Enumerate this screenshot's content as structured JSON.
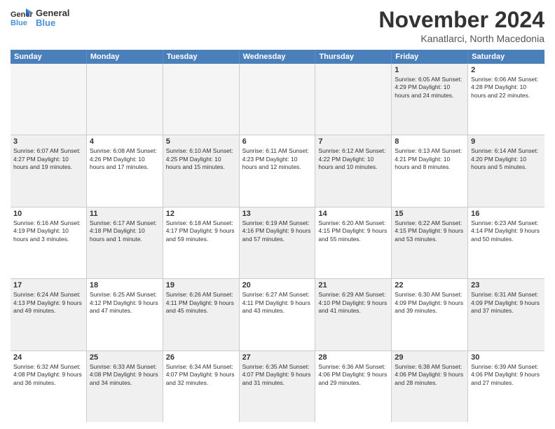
{
  "header": {
    "logo_line1": "General",
    "logo_line2": "Blue",
    "title": "November 2024",
    "location": "Kanatlarci, North Macedonia"
  },
  "weekdays": [
    "Sunday",
    "Monday",
    "Tuesday",
    "Wednesday",
    "Thursday",
    "Friday",
    "Saturday"
  ],
  "weeks": [
    [
      {
        "day": "",
        "info": "",
        "empty": true
      },
      {
        "day": "",
        "info": "",
        "empty": true
      },
      {
        "day": "",
        "info": "",
        "empty": true
      },
      {
        "day": "",
        "info": "",
        "empty": true
      },
      {
        "day": "",
        "info": "",
        "empty": true
      },
      {
        "day": "1",
        "info": "Sunrise: 6:05 AM\nSunset: 4:29 PM\nDaylight: 10 hours\nand 24 minutes.",
        "shaded": true
      },
      {
        "day": "2",
        "info": "Sunrise: 6:06 AM\nSunset: 4:28 PM\nDaylight: 10 hours\nand 22 minutes.",
        "shaded": false
      }
    ],
    [
      {
        "day": "3",
        "info": "Sunrise: 6:07 AM\nSunset: 4:27 PM\nDaylight: 10 hours\nand 19 minutes.",
        "shaded": true
      },
      {
        "day": "4",
        "info": "Sunrise: 6:08 AM\nSunset: 4:26 PM\nDaylight: 10 hours\nand 17 minutes.",
        "shaded": false
      },
      {
        "day": "5",
        "info": "Sunrise: 6:10 AM\nSunset: 4:25 PM\nDaylight: 10 hours\nand 15 minutes.",
        "shaded": true
      },
      {
        "day": "6",
        "info": "Sunrise: 6:11 AM\nSunset: 4:23 PM\nDaylight: 10 hours\nand 12 minutes.",
        "shaded": false
      },
      {
        "day": "7",
        "info": "Sunrise: 6:12 AM\nSunset: 4:22 PM\nDaylight: 10 hours\nand 10 minutes.",
        "shaded": true
      },
      {
        "day": "8",
        "info": "Sunrise: 6:13 AM\nSunset: 4:21 PM\nDaylight: 10 hours\nand 8 minutes.",
        "shaded": false
      },
      {
        "day": "9",
        "info": "Sunrise: 6:14 AM\nSunset: 4:20 PM\nDaylight: 10 hours\nand 5 minutes.",
        "shaded": true
      }
    ],
    [
      {
        "day": "10",
        "info": "Sunrise: 6:16 AM\nSunset: 4:19 PM\nDaylight: 10 hours\nand 3 minutes.",
        "shaded": false
      },
      {
        "day": "11",
        "info": "Sunrise: 6:17 AM\nSunset: 4:18 PM\nDaylight: 10 hours\nand 1 minute.",
        "shaded": true
      },
      {
        "day": "12",
        "info": "Sunrise: 6:18 AM\nSunset: 4:17 PM\nDaylight: 9 hours\nand 59 minutes.",
        "shaded": false
      },
      {
        "day": "13",
        "info": "Sunrise: 6:19 AM\nSunset: 4:16 PM\nDaylight: 9 hours\nand 57 minutes.",
        "shaded": true
      },
      {
        "day": "14",
        "info": "Sunrise: 6:20 AM\nSunset: 4:15 PM\nDaylight: 9 hours\nand 55 minutes.",
        "shaded": false
      },
      {
        "day": "15",
        "info": "Sunrise: 6:22 AM\nSunset: 4:15 PM\nDaylight: 9 hours\nand 53 minutes.",
        "shaded": true
      },
      {
        "day": "16",
        "info": "Sunrise: 6:23 AM\nSunset: 4:14 PM\nDaylight: 9 hours\nand 50 minutes.",
        "shaded": false
      }
    ],
    [
      {
        "day": "17",
        "info": "Sunrise: 6:24 AM\nSunset: 4:13 PM\nDaylight: 9 hours\nand 49 minutes.",
        "shaded": true
      },
      {
        "day": "18",
        "info": "Sunrise: 6:25 AM\nSunset: 4:12 PM\nDaylight: 9 hours\nand 47 minutes.",
        "shaded": false
      },
      {
        "day": "19",
        "info": "Sunrise: 6:26 AM\nSunset: 4:11 PM\nDaylight: 9 hours\nand 45 minutes.",
        "shaded": true
      },
      {
        "day": "20",
        "info": "Sunrise: 6:27 AM\nSunset: 4:11 PM\nDaylight: 9 hours\nand 43 minutes.",
        "shaded": false
      },
      {
        "day": "21",
        "info": "Sunrise: 6:29 AM\nSunset: 4:10 PM\nDaylight: 9 hours\nand 41 minutes.",
        "shaded": true
      },
      {
        "day": "22",
        "info": "Sunrise: 6:30 AM\nSunset: 4:09 PM\nDaylight: 9 hours\nand 39 minutes.",
        "shaded": false
      },
      {
        "day": "23",
        "info": "Sunrise: 6:31 AM\nSunset: 4:09 PM\nDaylight: 9 hours\nand 37 minutes.",
        "shaded": true
      }
    ],
    [
      {
        "day": "24",
        "info": "Sunrise: 6:32 AM\nSunset: 4:08 PM\nDaylight: 9 hours\nand 36 minutes.",
        "shaded": false
      },
      {
        "day": "25",
        "info": "Sunrise: 6:33 AM\nSunset: 4:08 PM\nDaylight: 9 hours\nand 34 minutes.",
        "shaded": true
      },
      {
        "day": "26",
        "info": "Sunrise: 6:34 AM\nSunset: 4:07 PM\nDaylight: 9 hours\nand 32 minutes.",
        "shaded": false
      },
      {
        "day": "27",
        "info": "Sunrise: 6:35 AM\nSunset: 4:07 PM\nDaylight: 9 hours\nand 31 minutes.",
        "shaded": true
      },
      {
        "day": "28",
        "info": "Sunrise: 6:36 AM\nSunset: 4:06 PM\nDaylight: 9 hours\nand 29 minutes.",
        "shaded": false
      },
      {
        "day": "29",
        "info": "Sunrise: 6:38 AM\nSunset: 4:06 PM\nDaylight: 9 hours\nand 28 minutes.",
        "shaded": true
      },
      {
        "day": "30",
        "info": "Sunrise: 6:39 AM\nSunset: 4:06 PM\nDaylight: 9 hours\nand 27 minutes.",
        "shaded": false
      }
    ]
  ]
}
